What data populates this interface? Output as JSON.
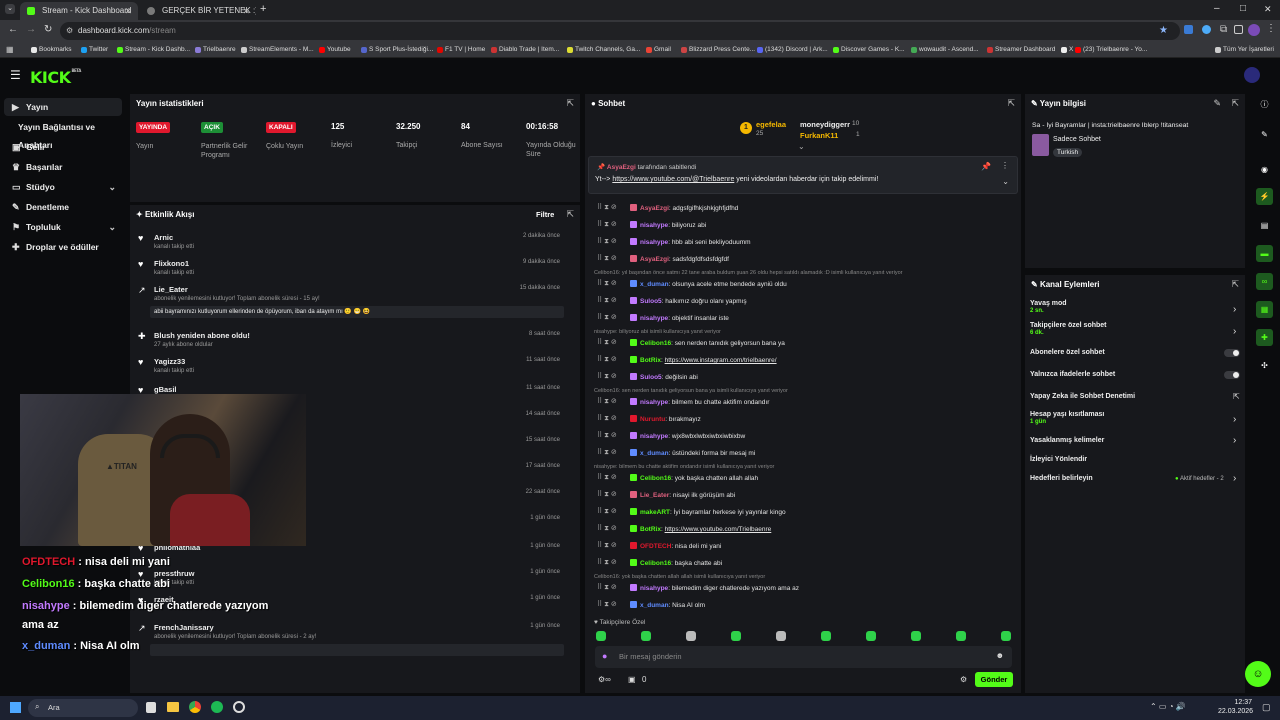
{
  "browser": {
    "tabs": [
      {
        "label": "Stream - Kick Dashboard",
        "active": true
      },
      {
        "label": "GERÇEK BİR YETENEK :) - Tier L",
        "active": false
      }
    ],
    "new_tab": "+",
    "window_controls": {
      "minimize": "–",
      "maximize": "□",
      "close": "✕"
    },
    "url": {
      "host": "dashboard.kick.com",
      "path": "/stream"
    },
    "bookmarks": [
      {
        "label": "Bookmarks",
        "color": "#e8e8e8"
      },
      {
        "label": "Twitter",
        "color": "#1da1f2"
      },
      {
        "label": "Stream - Kick Dashb...",
        "color": "#53fc18"
      },
      {
        "label": "Trielbaenre",
        "color": "#8a7bd6"
      },
      {
        "label": "StreamElements - M...",
        "color": "#cccccc"
      },
      {
        "label": "Youtube",
        "color": "#ff0000"
      },
      {
        "label": "S Sport Plus-İstediği...",
        "color": "#5566cc"
      },
      {
        "label": "F1 TV | Home",
        "color": "#e10600"
      },
      {
        "label": "Diablo Trade | Item...",
        "color": "#cc3333"
      },
      {
        "label": "Twitch Channels, Ga...",
        "color": "#dddd33"
      },
      {
        "label": "Gmail",
        "color": "#ea4335"
      },
      {
        "label": "Blizzard Press Cente...",
        "color": "#c44"
      },
      {
        "label": "(1342) Discord | Ark...",
        "color": "#5865f2"
      },
      {
        "label": "Discover Games - K...",
        "color": "#53fc18"
      },
      {
        "label": "wowaudit - Ascend...",
        "color": "#44aa55"
      },
      {
        "label": "Streamer Dashboard",
        "color": "#cc3333"
      },
      {
        "label": "X",
        "color": "#eeeeee"
      },
      {
        "label": "(23) Trielbaenre - Yo...",
        "color": "#ff0000"
      },
      {
        "label": "Tüm Yer İşaretleri",
        "color": "#cccccc"
      }
    ]
  },
  "kick": {
    "logo": "KICK",
    "beta": "BETA"
  },
  "sidebar": {
    "items": [
      {
        "label": "Yayın",
        "icon": "play-icon"
      },
      {
        "label": "Yayın Bağlantısı ve Anahtarı",
        "icon": ""
      },
      {
        "label": "Gelir",
        "icon": "wallet-icon"
      },
      {
        "label": "Başarılar",
        "icon": "trophy-icon"
      },
      {
        "label": "Stüdyo",
        "icon": "studio-icon"
      },
      {
        "label": "Denetleme",
        "icon": "wrench-icon"
      },
      {
        "label": "Topluluk",
        "icon": "community-icon"
      },
      {
        "label": "Droplar ve ödüller",
        "icon": "gift-icon"
      }
    ]
  },
  "stats": {
    "title": "Yayın istatistikleri",
    "items": [
      {
        "value": "YAYINDA",
        "label": "Yayın",
        "badge": true,
        "color": "#e0182d"
      },
      {
        "value": "AÇIK",
        "label": "Partnerlik Gelir Programı",
        "badge": true,
        "color": "#1d8f36"
      },
      {
        "value": "KAPALI",
        "label": "Çoklu Yayın",
        "badge": true,
        "color": "#e0182d"
      },
      {
        "value": "125",
        "label": "İzleyici",
        "badge": false
      },
      {
        "value": "32.250",
        "label": "Takipçi",
        "badge": false
      },
      {
        "value": "84",
        "label": "Abone Sayısı",
        "badge": false
      },
      {
        "value": "00:16:58",
        "label": "Yayında Olduğu Süre",
        "badge": false
      }
    ]
  },
  "events": {
    "title": "Etkinlik Akışı",
    "filter": "Filtre",
    "items": [
      {
        "name": "Arnic",
        "sub": "kanalı takip etti",
        "time": "2 dakika önce"
      },
      {
        "name": "Flixkono1",
        "sub": "kanalı takip etti",
        "time": "9 dakika önce"
      },
      {
        "name": "Lie_Eater",
        "sub": "abonelik yenilemesini kutluyor! Toplam abonelik süresi - 15 ay!",
        "time": "15 dakika önce",
        "msg": "abii bayramınızı kutluyorum ellerinden de öpüyorum, iban da atayım mı 🙂 😁 😆"
      },
      {
        "name": "Blush yeniden abone oldu!",
        "sub": "27 aylık abone oldular",
        "time": "8 saat önce"
      },
      {
        "name": "Yagizz33",
        "sub": "kanalı takip etti",
        "time": "11 saat önce"
      },
      {
        "name": "gBasil",
        "sub": "",
        "time": "11 saat önce"
      },
      {
        "name": "",
        "sub": "",
        "time": "14 saat önce"
      },
      {
        "name": "",
        "sub": "",
        "time": "15 saat önce"
      },
      {
        "name": "",
        "sub": "",
        "time": "17 saat önce"
      },
      {
        "name": "",
        "sub": "",
        "time": "22 saat önce"
      },
      {
        "name": "",
        "sub": "",
        "time": "1 gün önce"
      },
      {
        "name": "philomathiaa",
        "sub": "",
        "time": "1 gün önce"
      },
      {
        "name": "pressthruw",
        "sub": "kanalı takip etti",
        "time": "1 gün önce"
      },
      {
        "name": "rzaeit",
        "sub": "",
        "time": "1 gün önce"
      },
      {
        "name": "FrenchJanissary",
        "sub": "abonelik yenilemesini kutluyor! Toplam abonelik süresi - 2 ay!",
        "time": "1 gün önce"
      }
    ]
  },
  "chat": {
    "title": "Sohbet",
    "top_users": [
      {
        "name": "egefelaa",
        "count": "25"
      },
      {
        "name": "moneydiggerr",
        "count": "10"
      },
      {
        "name": "FurkanK11",
        "count": "1"
      }
    ],
    "pinned": {
      "by": "AsyaEzgi",
      "by_suffix": "tarafından sabitlendi",
      "prefix": "Yt-->",
      "link": "https://www.youtube.com/@Trielbaenre",
      "text": "yeni videolardan haberdar için takip edelimmi!"
    },
    "messages": [
      {
        "user": "AsyaEzgi",
        "color": "#e0607e",
        "text": "adgsfgifhkjshkjghfjdfhd"
      },
      {
        "user": "nisahype",
        "color": "#c27aff",
        "text": "biliyoruz abi"
      },
      {
        "user": "nisahype",
        "color": "#c27aff",
        "text": "hbb abi seni bekliyoduumm"
      },
      {
        "user": "AsyaEzgi",
        "color": "#e0607e",
        "text": "sadsfdgfdfsdsfdgfdf"
      },
      {
        "reply": "Celibon16: yıl başından önce satmı 22 tane araba buldum şuan 26 oldu hepsi satıldı alamadık :D isimli kullanıcıya yanıt veriyor"
      },
      {
        "user": "x_duman",
        "color": "#5f8cff",
        "text": "olsunya acele etme bendede ayniü oldu"
      },
      {
        "user": "Suloo5",
        "color": "#c27aff",
        "text": "halkımız doğru olanı yapmış"
      },
      {
        "user": "nisahype",
        "color": "#c27aff",
        "text": "objektif insanlar iste"
      },
      {
        "reply": "nisahype: biliyoruz abi isimli kullanıcıya yanıt veriyor"
      },
      {
        "user": "Celibon16",
        "color": "#53fc18",
        "text": "sen nerden tanıdık geliyorsun bana ya"
      },
      {
        "user": "BotRix",
        "color": "#53fc18",
        "text": "https://www.instagram.com/trielbaenre/",
        "link": true
      },
      {
        "user": "Suloo5",
        "color": "#c27aff",
        "text": "değilsin abi"
      },
      {
        "reply": "Celibon16: sen nerden tanıdık geliyorsun bana ya isimli kullanıcıya yanıt veriyor"
      },
      {
        "user": "nisahype",
        "color": "#c27aff",
        "text": "bilmem bu chatte aktifim ondandır"
      },
      {
        "user": "Nuruntu",
        "color": "#e0182d",
        "text": "bırakmayız"
      },
      {
        "user": "nisahype",
        "color": "#c27aff",
        "text": "wjx8wbxlwbxiwbxiwbixbw"
      },
      {
        "user": "x_duman",
        "color": "#5f8cff",
        "text": "üstündeki forma bir mesaj mi"
      },
      {
        "reply": "nisahype: bilmem bu chatte aktifim ondandır isimli kullanıcıya yanıt veriyor"
      },
      {
        "user": "Celibon16",
        "color": "#53fc18",
        "text": "yok başka chatten allah allah"
      },
      {
        "user": "Lie_Eater",
        "color": "#e0607e",
        "text": "nisayi ilk görüşüm abi"
      },
      {
        "user": "makeART",
        "color": "#53fc18",
        "text": "İyi bayramlar herkese iyi yayınlar kingo"
      },
      {
        "user": "BotRix",
        "color": "#53fc18",
        "text": "https://www.youtube.com/Trielbaenre",
        "link": true
      },
      {
        "user": "OFDTECH",
        "color": "#e0182d",
        "text": "nisa deli mi yani"
      },
      {
        "user": "Celibon16",
        "color": "#53fc18",
        "text": "başka chatte abi"
      },
      {
        "reply": "Celibon16: yok başka chatten allah allah isimli kullanıcıya yanıt veriyor"
      },
      {
        "user": "nisahype",
        "color": "#c27aff",
        "text": "bilemedim diger chatlerede yazıyom ama az"
      },
      {
        "user": "x_duman",
        "color": "#5f8cff",
        "text": "Nisa AI olm"
      }
    ],
    "followers_only": "Takipçilere Özel",
    "placeholder": "Bir mesaj gönderin",
    "send": "Gönder",
    "points": "0"
  },
  "stream_info": {
    "title": "Yayın bilgisi",
    "stream_title": "Sa - İyi Bayramlar | insta:trielbaenre Iblerp !titanseat",
    "category": "Sadece Sohbet",
    "tag": "Turkish"
  },
  "channel_actions": {
    "title": "Kanal Eylemleri",
    "items": [
      {
        "label": "Yavaş mod",
        "sub": "2 sn.",
        "control": "arrow"
      },
      {
        "label": "Takipçilere özel sohbet",
        "sub": "6 dk.",
        "control": "arrow"
      },
      {
        "label": "Abonelere özel sohbet",
        "sub": "",
        "control": "toggle"
      },
      {
        "label": "Yalnızca ifadelerle sohbet",
        "sub": "",
        "control": "toggle"
      },
      {
        "label": "Yapay Zeka ile Sohbet Denetimi",
        "sub": "",
        "control": "open"
      },
      {
        "label": "Hesap yaşı kısıtlaması",
        "sub": "1 gün",
        "control": "arrow"
      },
      {
        "label": "Yasaklanmış kelimeler",
        "sub": "",
        "control": "arrow"
      },
      {
        "label": "İzleyici Yönlendir",
        "sub": "",
        "control": "none"
      },
      {
        "label": "Hedefleri belirleyin",
        "sub": "",
        "control": "arrow",
        "extra": "Aktif hedefler - 2"
      }
    ]
  },
  "overlay_chat": [
    {
      "user": "OFDTECH",
      "color": "#e0182d",
      "text": "nisa deli mi yani"
    },
    {
      "user": "Celibon16",
      "color": "#53fc18",
      "text": "başka chatte abi"
    },
    {
      "user": "nisahype",
      "color": "#c27aff",
      "text": "bilemedim diger chatlerede yazıyom"
    },
    {
      "user": "",
      "color": "#ffffff",
      "text": "ama az"
    },
    {
      "user": "x_duman",
      "color": "#5f8cff",
      "text": "Nisa AI olm"
    }
  ],
  "taskbar": {
    "search": "Ara",
    "time": "12:37",
    "date": "22.03.2026"
  }
}
